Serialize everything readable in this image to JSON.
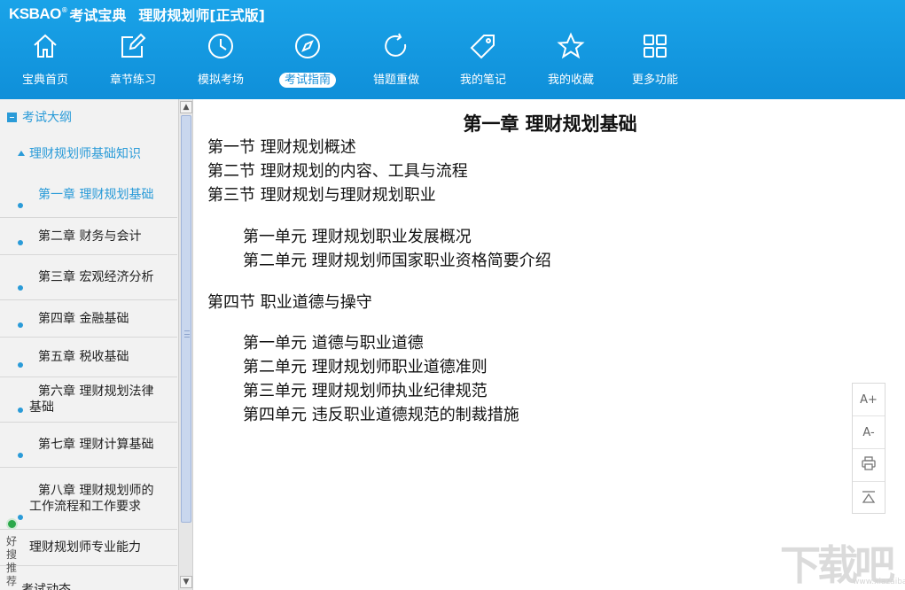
{
  "app": {
    "brand": "KSBAO",
    "brand_reg": "®",
    "brand_cn": "考试宝典",
    "title": "理财规划师[正式版]"
  },
  "nav": [
    {
      "label": "宝典首页",
      "icon": "home-icon",
      "active": false
    },
    {
      "label": "章节练习",
      "icon": "edit-icon",
      "active": false
    },
    {
      "label": "模拟考场",
      "icon": "clock-icon",
      "active": false
    },
    {
      "label": "考试指南",
      "icon": "compass-icon",
      "active": true
    },
    {
      "label": "错题重做",
      "icon": "refresh-icon",
      "active": false
    },
    {
      "label": "我的笔记",
      "icon": "tag-icon",
      "active": false
    },
    {
      "label": "我的收藏",
      "icon": "star-icon",
      "active": false
    },
    {
      "label": "更多功能",
      "icon": "grid-icon",
      "active": false
    }
  ],
  "sidebar": {
    "root": "考试大纲",
    "section": "理财规划师基础知识",
    "items": [
      {
        "label": "第一章 理财规划基础",
        "active": true
      },
      {
        "label": "第二章 财务与会计",
        "active": false
      },
      {
        "label": "第三章 宏观经济分析",
        "active": false
      },
      {
        "label": "第四章 金融基础",
        "active": false
      },
      {
        "label": "第五章 税收基础",
        "active": false
      },
      {
        "label": "第六章 理财规划法律基础",
        "active": false
      },
      {
        "label": "第七章 理财计算基础",
        "active": false
      },
      {
        "label": "第八章 理财规划师的工作流程和工作要求",
        "active": false
      }
    ],
    "section2": "理财规划师专业能力",
    "partial": "考试动态",
    "recommend": "好搜推荐"
  },
  "content": {
    "title": "第一章 理财规划基础",
    "lines": [
      "第一节 理财规划概述",
      "第二节 理财规划的内容、工具与流程",
      "第三节 理财规划与理财规划职业",
      "第一单元 理财规划职业发展概况",
      "第二单元 理财规划师国家职业资格简要介绍",
      "第四节 职业道德与操守",
      "第一单元 道德与职业道德",
      "第二单元 理财规划师职业道德准则",
      "第三单元 理财规划师执业纪律规范",
      "第四单元 违反职业道德规范的制裁措施"
    ]
  },
  "tools": {
    "font_up": "A+",
    "font_down": "A-",
    "print_icon": "print-icon",
    "top_icon": "back-to-top-icon"
  },
  "watermark": {
    "text": "下载吧",
    "url": "www.xiazaiba.com"
  },
  "colors": {
    "header_bg": "#1599e0",
    "accent": "#2a9bd8",
    "sidebar_bg": "#f2f2f2"
  }
}
